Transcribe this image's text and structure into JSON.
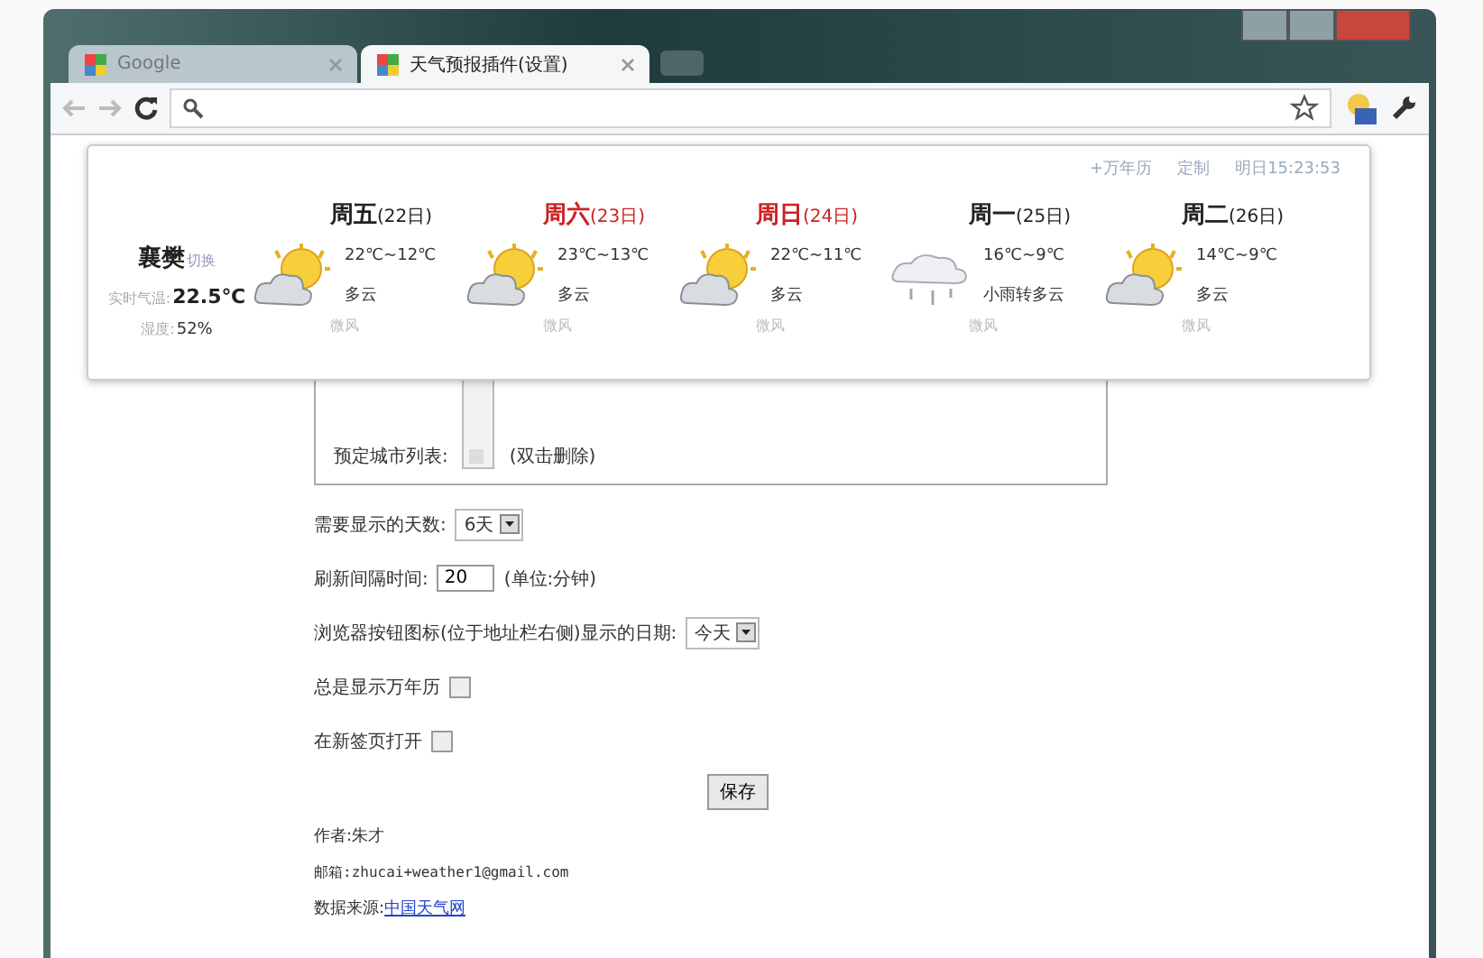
{
  "window": {
    "tabs": [
      {
        "label": "Google",
        "selected": false
      },
      {
        "label": "天气预报插件(设置)",
        "selected": true
      }
    ]
  },
  "popup": {
    "links": [
      "+万年历",
      "定制",
      "明日15:23:53"
    ],
    "current": {
      "city": "襄樊",
      "switch": "切换",
      "temp_label": "实时气温:",
      "temp": "22.5℃",
      "humidity_label": "湿度:",
      "humidity": "52%"
    },
    "days": [
      {
        "day": "周五",
        "date": "(22日)",
        "color": "#222222",
        "kind": "cloudy",
        "temp": "22℃~12℃",
        "weather": "多云",
        "wind": "微风"
      },
      {
        "day": "周六",
        "date": "(23日)",
        "color": "#cc2222",
        "kind": "cloudy",
        "temp": "23℃~13℃",
        "weather": "多云",
        "wind": "微风"
      },
      {
        "day": "周日",
        "date": "(24日)",
        "color": "#cc2222",
        "kind": "cloudy",
        "temp": "22℃~11℃",
        "weather": "多云",
        "wind": "微风"
      },
      {
        "day": "周一",
        "date": "(25日)",
        "color": "#222222",
        "kind": "rain",
        "temp": "16℃~9℃",
        "weather": "小雨转多云",
        "wind": "微风"
      },
      {
        "day": "周二",
        "date": "(26日)",
        "color": "#222222",
        "kind": "cloudy",
        "temp": "14℃~9℃",
        "weather": "多云",
        "wind": "微风"
      }
    ]
  },
  "settings": {
    "city_list_label": "预定城市列表:",
    "city_list_hint": "(双击删除)",
    "days_label": "需要显示的天数:",
    "days_value": "6天",
    "refresh_label": "刷新间隔时间:",
    "refresh_value": "20",
    "refresh_unit": "(单位:分钟)",
    "icon_date_label": "浏览器按钮图标(位于地址栏右侧)显示的日期:",
    "icon_date_value": "今天",
    "checkboxes": [
      {
        "label": "总是显示万年历",
        "checked": false
      },
      {
        "label": "在新签页打开",
        "checked": false
      }
    ],
    "save": "保存",
    "author": "作者:朱才",
    "email": "邮箱:zhucai+weather1@gmail.com",
    "source_label": "数据来源:",
    "source_link": "中国天气网"
  }
}
